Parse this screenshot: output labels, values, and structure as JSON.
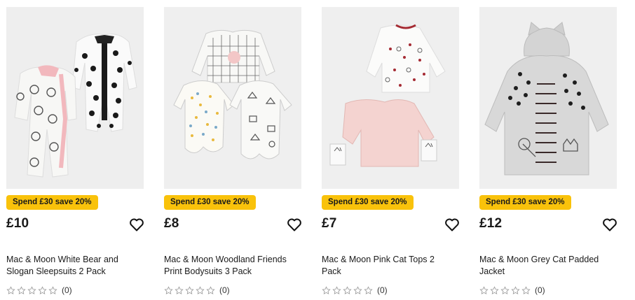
{
  "products": [
    {
      "promo": "Spend £30 save 20%",
      "price": "£10",
      "title": "Mac & Moon White Bear and Slogan Sleepsuits 2 Pack",
      "rating_count": "(0)",
      "image_alt": "White bear and polka dot sleepsuits"
    },
    {
      "promo": "Spend £30 save 20%",
      "price": "£8",
      "title": "Mac & Moon Woodland Friends Print Bodysuits 3 Pack",
      "rating_count": "(0)",
      "image_alt": "Woodland print bodysuits"
    },
    {
      "promo": "Spend £30 save 20%",
      "price": "£7",
      "title": "Mac & Moon Pink Cat Tops 2 Pack",
      "rating_count": "(0)",
      "image_alt": "Pink and white cat tops"
    },
    {
      "promo": "Spend £30 save 20%",
      "price": "£12",
      "title": "Mac & Moon Grey Cat Padded Jacket",
      "rating_count": "(0)",
      "image_alt": "Grey padded jacket with cat ears"
    }
  ],
  "icons": {
    "favourite": "heart-outline-icon",
    "star": "star-outline-icon"
  },
  "colors": {
    "promo_badge": "#f9c20b",
    "photo_bg": "#efefef",
    "star_outline": "#9a9a9a"
  }
}
